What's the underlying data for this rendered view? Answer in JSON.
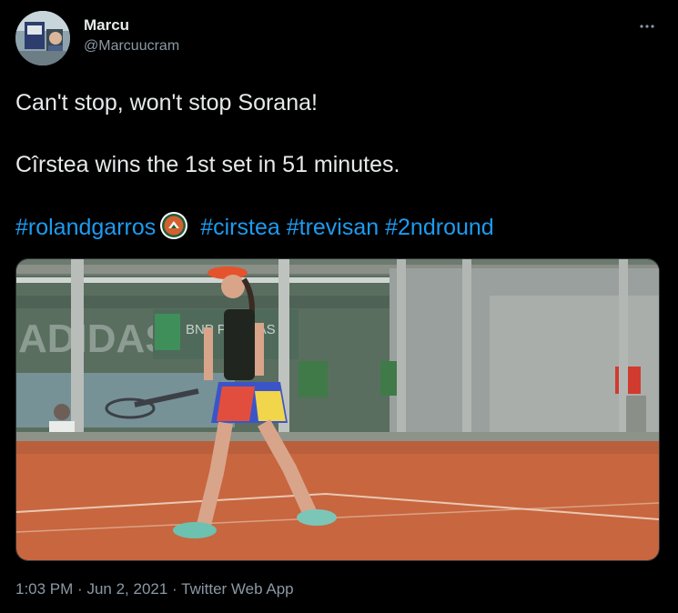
{
  "user": {
    "display_name": "Marcu",
    "handle": "@Marcuucram"
  },
  "tweet": {
    "line1": "Can't stop, won't stop Sorana!",
    "line2": "Cîrstea wins the 1st set in 51 minutes.",
    "hashtags": [
      "#rolandgarros",
      "#cirstea",
      "#trevisan",
      "#2ndround"
    ]
  },
  "media": {
    "type": "video-frame",
    "board_text": "BNP PARIBAS",
    "sign_text": "ADIDAS"
  },
  "footer": {
    "time": "1:03 PM",
    "date": "Jun 2, 2021",
    "source": "Twitter Web App",
    "separator": "·"
  },
  "icons": {
    "more": "more-horizontal-icon",
    "rg_emoji": "roland-garros-logo-emoji"
  },
  "colors": {
    "background": "#000000",
    "text": "#e7e9ea",
    "muted": "#8b98a5",
    "link": "#1d9bf0",
    "clay": "#c8663f"
  }
}
